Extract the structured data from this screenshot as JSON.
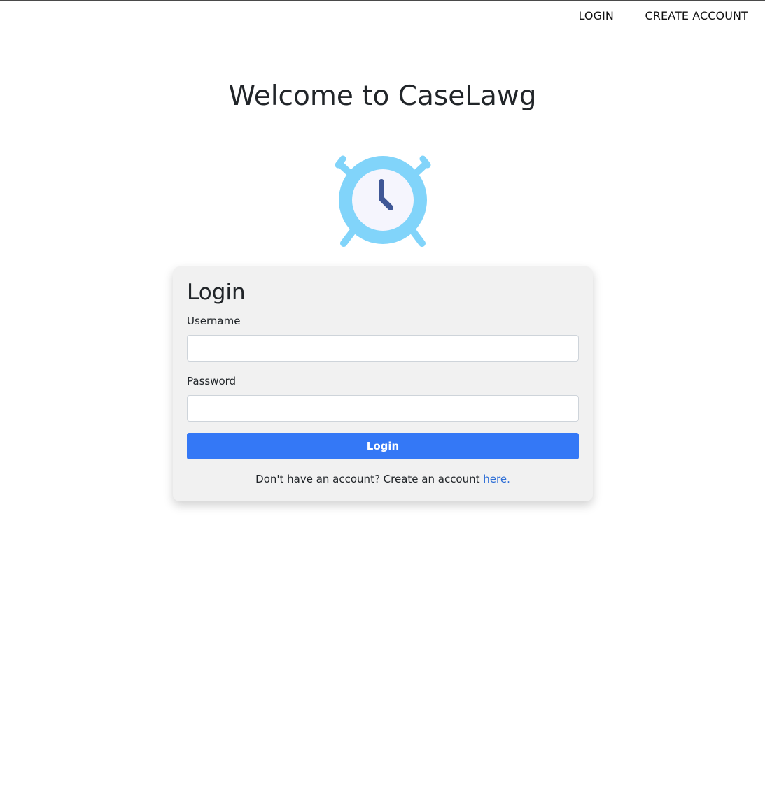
{
  "nav": {
    "login_label": "LOGIN",
    "create_account_label": "CREATE ACCOUNT"
  },
  "page": {
    "title": "Welcome to CaseLawg"
  },
  "logo": {
    "icon": "alarm-clock-icon",
    "colors": {
      "body": "#81d4fa",
      "face": "#f5f5fd",
      "hands": "#3f5796"
    }
  },
  "login_form": {
    "title": "Login",
    "username_label": "Username",
    "username_value": "",
    "password_label": "Password",
    "password_value": "",
    "submit_label": "Login",
    "signup_prompt": "Don't have an account? Create an account ",
    "signup_link_label": "here."
  },
  "colors": {
    "primary": "#3478f6",
    "link": "#2f6fd6",
    "card_background": "#f1f1f1"
  }
}
